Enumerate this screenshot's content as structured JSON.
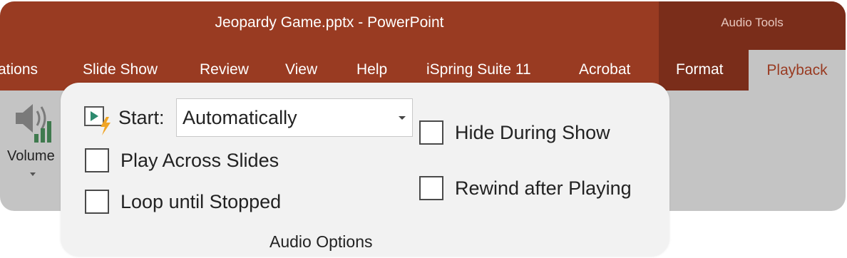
{
  "title": "Jeopardy Game.pptx  -  PowerPoint",
  "contextual_group": "Audio Tools",
  "tabs": [
    {
      "label": "ations"
    },
    {
      "label": "Slide Show"
    },
    {
      "label": "Review"
    },
    {
      "label": "View"
    },
    {
      "label": "Help"
    },
    {
      "label": "iSpring Suite 11"
    },
    {
      "label": "Acrobat"
    },
    {
      "label": "Format"
    },
    {
      "label": "Playback",
      "active": true
    }
  ],
  "ribbon": {
    "volume_label": "Volume",
    "audio_options": {
      "start_label": "Start:",
      "start_value": "Automatically",
      "play_across_slides": {
        "label": "Play Across Slides",
        "checked": false
      },
      "loop_until_stopped": {
        "label": "Loop until Stopped",
        "checked": false
      },
      "hide_during_show": {
        "label": "Hide During Show",
        "checked": false
      },
      "rewind_after_playing": {
        "label": "Rewind after Playing",
        "checked": false
      },
      "group_label": "Audio Options"
    }
  },
  "colors": {
    "title_bar": "#993b22",
    "contextual_band": "#7a2d1a",
    "ribbon_bg": "#c4c4c4",
    "popup_bg": "#f2f2f2",
    "active_tab_text": "#993b22"
  },
  "icons": {
    "volume": "speaker-volume-icon",
    "start": "play-start-icon",
    "dropdown": "chevron-down-icon"
  }
}
